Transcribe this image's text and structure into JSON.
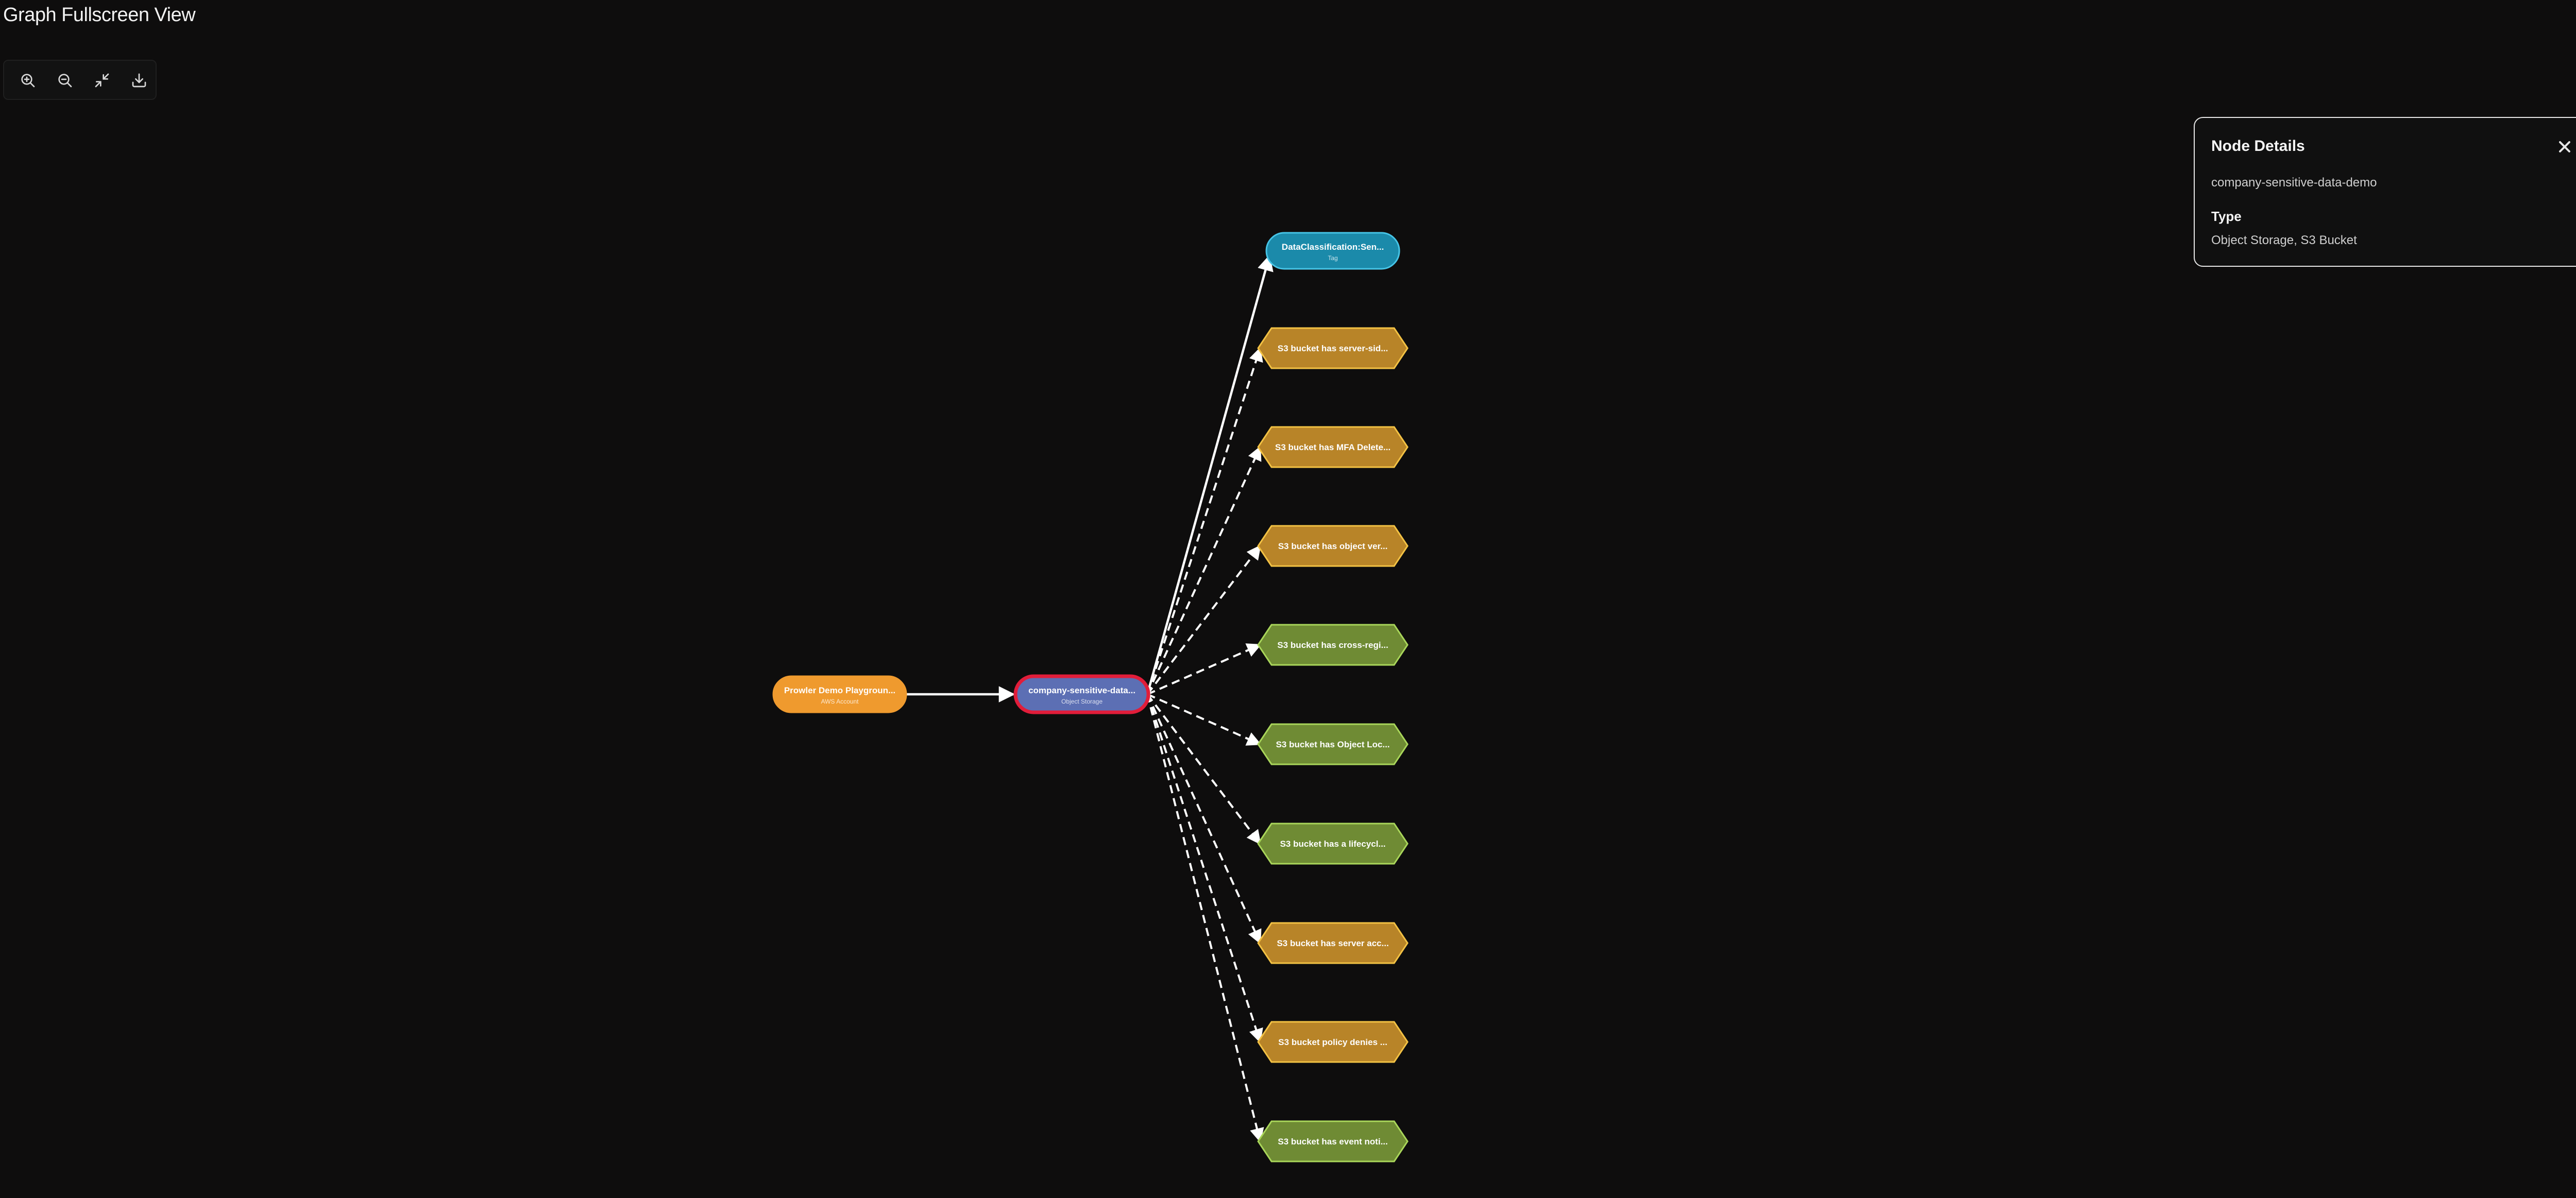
{
  "page": {
    "title": "Graph Fullscreen View",
    "close_icon": "close-icon"
  },
  "toolbar": {
    "buttons": [
      {
        "name": "zoom-in-button",
        "icon": "zoom-in-icon"
      },
      {
        "name": "zoom-out-button",
        "icon": "zoom-out-icon"
      },
      {
        "name": "fit-view-button",
        "icon": "minimize-icon"
      },
      {
        "name": "download-button",
        "icon": "download-icon"
      }
    ]
  },
  "graph": {
    "nodes": [
      {
        "id": "account",
        "label": "Prowler Demo Playgroun...",
        "sublabel": "AWS Account",
        "kind": "pill",
        "fill": "#ef9a2e",
        "stroke": "#ef9a2e"
      },
      {
        "id": "bucket",
        "label": "company-sensitive-data...",
        "sublabel": "Object Storage",
        "kind": "pill",
        "fill": "#5c6fb4",
        "stroke": "#e11d3a",
        "selected": true
      },
      {
        "id": "tag",
        "label": "DataClassification:Sen...",
        "sublabel": "Tag",
        "kind": "pill",
        "fill": "#1b8aaa",
        "stroke": "#46c4e6"
      },
      {
        "id": "f1",
        "label": "S3 bucket has server-sid...",
        "kind": "hex",
        "fill": "#b88428",
        "stroke": "#f3c244"
      },
      {
        "id": "f2",
        "label": "S3 bucket has MFA Delete...",
        "kind": "hex",
        "fill": "#b88428",
        "stroke": "#f3c244"
      },
      {
        "id": "f3",
        "label": "S3 bucket has object ver...",
        "kind": "hex",
        "fill": "#b88428",
        "stroke": "#f3c244"
      },
      {
        "id": "f4",
        "label": "S3 bucket has cross-regi...",
        "kind": "hex",
        "fill": "#6f8b34",
        "stroke": "#a9d65a"
      },
      {
        "id": "f5",
        "label": "S3 bucket has Object Loc...",
        "kind": "hex",
        "fill": "#6f8b34",
        "stroke": "#a9d65a"
      },
      {
        "id": "f6",
        "label": "S3 bucket has a lifecycl...",
        "kind": "hex",
        "fill": "#6f8b34",
        "stroke": "#a9d65a"
      },
      {
        "id": "f7",
        "label": "S3 bucket has server acc...",
        "kind": "hex",
        "fill": "#b88428",
        "stroke": "#f3c244"
      },
      {
        "id": "f8",
        "label": "S3 bucket policy denies ...",
        "kind": "hex",
        "fill": "#b88428",
        "stroke": "#f3c244"
      },
      {
        "id": "f9",
        "label": "S3 bucket has event noti...",
        "kind": "hex",
        "fill": "#6f8b34",
        "stroke": "#a9d65a"
      }
    ],
    "edges": [
      {
        "from": "account",
        "to": "bucket",
        "style": "solid"
      },
      {
        "from": "bucket",
        "to": "tag",
        "style": "solid"
      },
      {
        "from": "bucket",
        "to": "f1",
        "style": "dashed"
      },
      {
        "from": "bucket",
        "to": "f2",
        "style": "dashed"
      },
      {
        "from": "bucket",
        "to": "f3",
        "style": "dashed"
      },
      {
        "from": "bucket",
        "to": "f4",
        "style": "dashed"
      },
      {
        "from": "bucket",
        "to": "f5",
        "style": "dashed"
      },
      {
        "from": "bucket",
        "to": "f6",
        "style": "dashed"
      },
      {
        "from": "bucket",
        "to": "f7",
        "style": "dashed"
      },
      {
        "from": "bucket",
        "to": "f8",
        "style": "dashed"
      },
      {
        "from": "bucket",
        "to": "f9",
        "style": "dashed"
      }
    ]
  },
  "details": {
    "title": "Node Details",
    "name": "company-sensitive-data-demo",
    "type_label": "Type",
    "type_value": "Object Storage, S3 Bucket",
    "close_icon": "close-icon"
  }
}
